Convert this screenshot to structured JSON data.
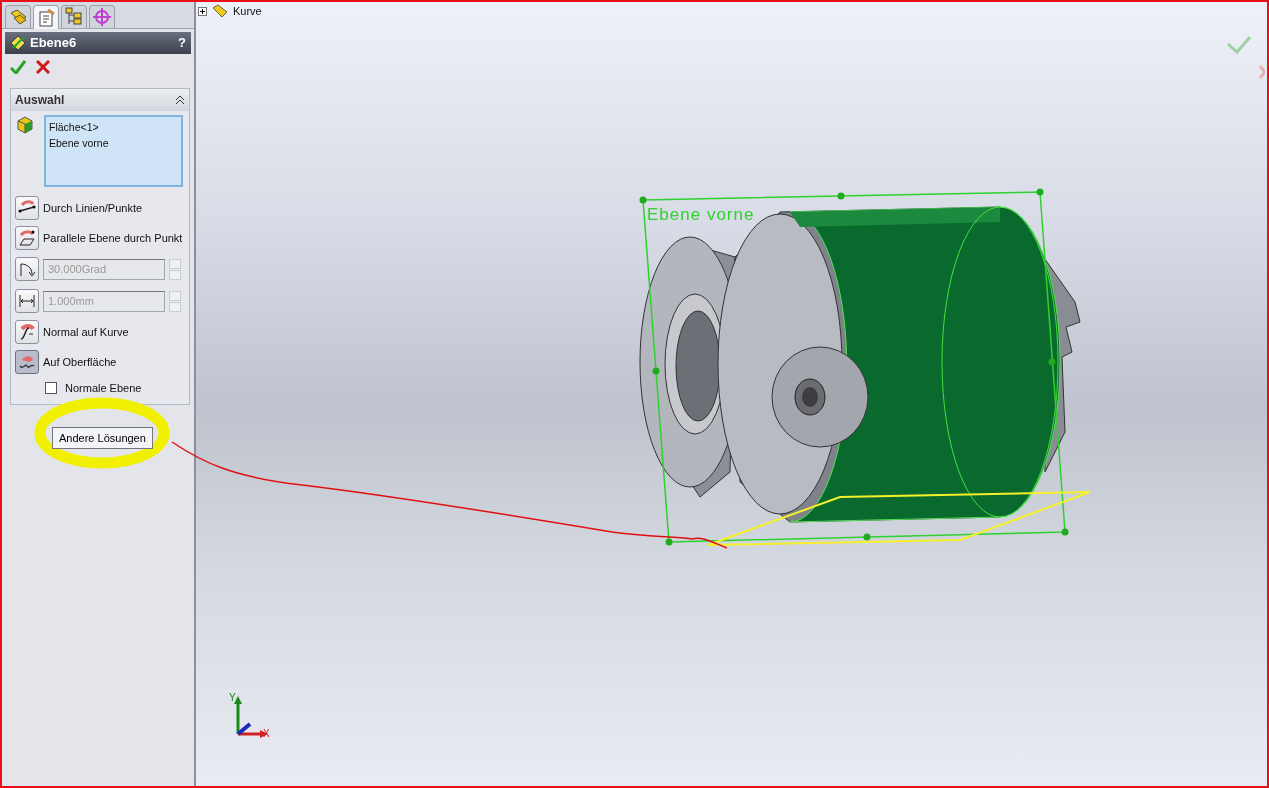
{
  "panel_tabs": [
    {
      "kind": "features",
      "selected": false
    },
    {
      "kind": "properties",
      "selected": true
    },
    {
      "kind": "configurations",
      "selected": false
    },
    {
      "kind": "display",
      "selected": false
    }
  ],
  "property_manager": {
    "title": "Ebene6",
    "help": "?"
  },
  "selection_group": {
    "header": "Auswahl",
    "expanded": true,
    "items": [
      "Fläche<1>",
      "Ebene vorne"
    ]
  },
  "options": [
    {
      "kind": "toggle",
      "label": "Durch Linien/Punkte",
      "selected": false
    },
    {
      "kind": "toggle",
      "label": "Parallele Ebene durch Punkt",
      "selected": false
    },
    {
      "kind": "spinner",
      "value": "30.000Grad",
      "disabled": true
    },
    {
      "kind": "spinner",
      "value": "1.000mm",
      "disabled": true
    },
    {
      "kind": "toggle",
      "label": "Normal auf Kurve",
      "selected": false
    },
    {
      "kind": "toggle",
      "label": "Auf Oberfläche",
      "selected": true
    },
    {
      "kind": "checkbox",
      "label": "Normale Ebene",
      "checked": false
    }
  ],
  "other_solutions_button": "Andere Lösungen",
  "tree": {
    "label": "Kurve",
    "expanded": false
  },
  "viewport": {
    "plane_label": "Ebene vorne",
    "axis_y": "Y",
    "axis_x": "X"
  }
}
